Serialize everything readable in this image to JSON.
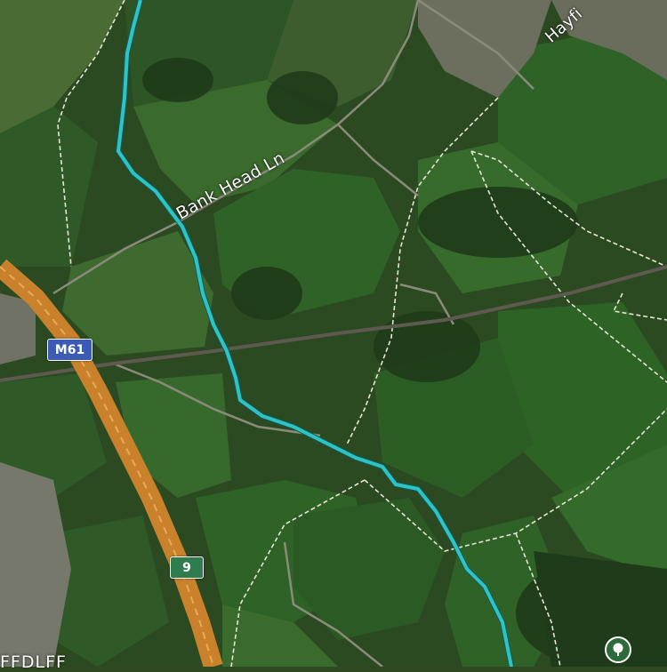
{
  "map": {
    "view": "satellite",
    "labels": {
      "bank_head_ln": "Bank Head Ln",
      "hayfield": "Hayfi",
      "bottom": "FFDLFF"
    },
    "shields": {
      "motorway": "M61",
      "junction": "9"
    },
    "icons": {
      "park": "tree-icon"
    },
    "colors": {
      "route": "#2ec4c4",
      "motorway": "#d8892e",
      "footpath": "#e6e6d6",
      "field": "#2f5a27",
      "motorway_shield": "#3b5bb5",
      "junction_shield": "#2f7d4e"
    }
  }
}
